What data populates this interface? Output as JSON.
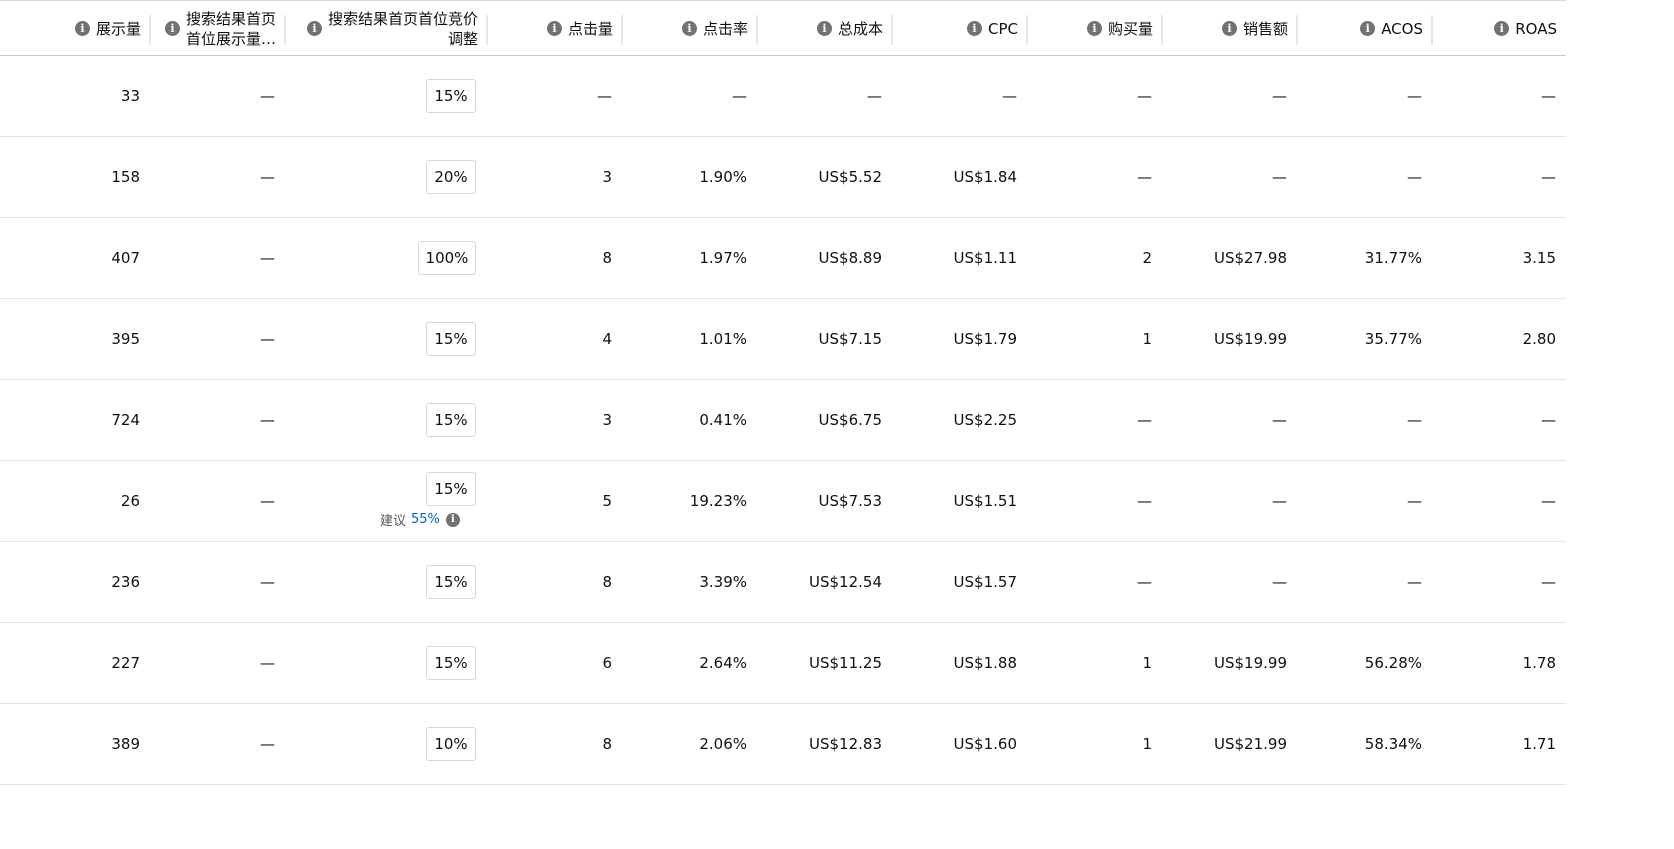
{
  "columns": [
    {
      "key": "impressions",
      "label": "展示量"
    },
    {
      "key": "tos_impr",
      "label": "搜索结果首页 首位展示量…",
      "line1": "搜索结果首页",
      "line2": "首位展示量…"
    },
    {
      "key": "tos_bid_adj",
      "label": "搜索结果首页首位竞价调整",
      "line1": "搜索结果首页首位竞价",
      "line2": "调整"
    },
    {
      "key": "clicks",
      "label": "点击量"
    },
    {
      "key": "ctr",
      "label": "点击率"
    },
    {
      "key": "cost",
      "label": "总成本"
    },
    {
      "key": "cpc",
      "label": "CPC"
    },
    {
      "key": "purchases",
      "label": "购买量"
    },
    {
      "key": "sales",
      "label": "销售额"
    },
    {
      "key": "acos",
      "label": "ACOS"
    },
    {
      "key": "roas",
      "label": "ROAS"
    }
  ],
  "rows": [
    {
      "impressions": "33",
      "tos_impr": "—",
      "tos_bid_adj": "15%",
      "clicks": "—",
      "ctr": "—",
      "cost": "—",
      "cpc": "—",
      "purchases": "—",
      "sales": "—",
      "acos": "—",
      "roas": "—"
    },
    {
      "impressions": "158",
      "tos_impr": "—",
      "tos_bid_adj": "20%",
      "clicks": "3",
      "ctr": "1.90%",
      "cost": "US$5.52",
      "cpc": "US$1.84",
      "purchases": "—",
      "sales": "—",
      "acos": "—",
      "roas": "—"
    },
    {
      "impressions": "407",
      "tos_impr": "—",
      "tos_bid_adj": "100%",
      "clicks": "8",
      "ctr": "1.97%",
      "cost": "US$8.89",
      "cpc": "US$1.11",
      "purchases": "2",
      "sales": "US$27.98",
      "acos": "31.77%",
      "roas": "3.15"
    },
    {
      "impressions": "395",
      "tos_impr": "—",
      "tos_bid_adj": "15%",
      "clicks": "4",
      "ctr": "1.01%",
      "cost": "US$7.15",
      "cpc": "US$1.79",
      "purchases": "1",
      "sales": "US$19.99",
      "acos": "35.77%",
      "roas": "2.80"
    },
    {
      "impressions": "724",
      "tos_impr": "—",
      "tos_bid_adj": "15%",
      "clicks": "3",
      "ctr": "0.41%",
      "cost": "US$6.75",
      "cpc": "US$2.25",
      "purchases": "—",
      "sales": "—",
      "acos": "—",
      "roas": "—"
    },
    {
      "impressions": "26",
      "tos_impr": "—",
      "tos_bid_adj": "15%",
      "suggest_label": "建议",
      "suggest_value": "55%",
      "clicks": "5",
      "ctr": "19.23%",
      "cost": "US$7.53",
      "cpc": "US$1.51",
      "purchases": "—",
      "sales": "—",
      "acos": "—",
      "roas": "—"
    },
    {
      "impressions": "236",
      "tos_impr": "—",
      "tos_bid_adj": "15%",
      "clicks": "8",
      "ctr": "3.39%",
      "cost": "US$12.54",
      "cpc": "US$1.57",
      "purchases": "—",
      "sales": "—",
      "acos": "—",
      "roas": "—"
    },
    {
      "impressions": "227",
      "tos_impr": "—",
      "tos_bid_adj": "15%",
      "clicks": "6",
      "ctr": "2.64%",
      "cost": "US$11.25",
      "cpc": "US$1.88",
      "purchases": "1",
      "sales": "US$19.99",
      "acos": "56.28%",
      "roas": "1.78"
    },
    {
      "impressions": "389",
      "tos_impr": "—",
      "tos_bid_adj": "10%",
      "clicks": "8",
      "ctr": "2.06%",
      "cost": "US$12.83",
      "cpc": "US$1.60",
      "purchases": "1",
      "sales": "US$21.99",
      "acos": "58.34%",
      "roas": "1.71"
    }
  ],
  "icons": {
    "column_info": "info-icon"
  },
  "colors": {
    "link": "#0066c0",
    "info_icon": "#6f7373",
    "border": "#d5d9d9"
  }
}
